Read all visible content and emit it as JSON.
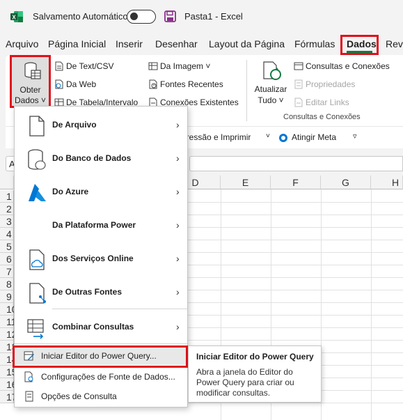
{
  "titlebar": {
    "autosave_label": "Salvamento Automático",
    "doc_title": "Pasta1  -  Excel"
  },
  "tabs": [
    {
      "label": "Arquivo"
    },
    {
      "label": "Página Inicial"
    },
    {
      "label": "Inserir"
    },
    {
      "label": "Desenhar"
    },
    {
      "label": "Layout da Página"
    },
    {
      "label": "Fórmulas"
    },
    {
      "label": "Dados"
    },
    {
      "label": "Revi"
    }
  ],
  "ribbon": {
    "obter_line1": "Obter",
    "obter_line2": "Dados ˅",
    "get_items": [
      "De Text/CSV",
      "Da Web",
      "De Tabela/Intervalo"
    ],
    "get_items2": [
      "Da Imagem ˅",
      "Fontes Recentes",
      "Conexões Existentes"
    ],
    "atualizar_line1": "Atualizar",
    "atualizar_line2": "Tudo ˅",
    "query_items": [
      "Consultas e Conexões",
      "Propriedades",
      "Editar Links"
    ],
    "query_group_label": "Consultas e Conexões",
    "row2_print": "pressão e Imprimir",
    "row2_goal": "Atingir Meta"
  },
  "namebox": "A",
  "columns": [
    "D",
    "E",
    "F",
    "G",
    "H"
  ],
  "rows": [
    "1",
    "2",
    "3",
    "4",
    "5",
    "6",
    "7",
    "8",
    "9",
    "10",
    "11",
    "12",
    "13",
    "14",
    "15",
    "16",
    "17"
  ],
  "menu": {
    "items": [
      {
        "label": "De Arquivo"
      },
      {
        "label": "Do Banco de Dados"
      },
      {
        "label": "Do Azure"
      },
      {
        "label": "Da Plataforma Power"
      },
      {
        "label": "Dos Serviços Online"
      },
      {
        "label": "De Outras Fontes"
      },
      {
        "label": "Combinar Consultas"
      }
    ],
    "small_items": [
      {
        "label": "Iniciar Editor do Power Query..."
      },
      {
        "label": "Configurações de Fonte de Dados..."
      },
      {
        "label": "Opções de Consulta"
      }
    ]
  },
  "tooltip": {
    "title": "Iniciar Editor do Power Query",
    "body": "Abra a janela do Editor do Power Query para criar ou modificar consultas."
  },
  "colors": {
    "excel_green": "#107c41",
    "highlight_red": "#e0111c",
    "azure_blue": "#0078d4"
  }
}
